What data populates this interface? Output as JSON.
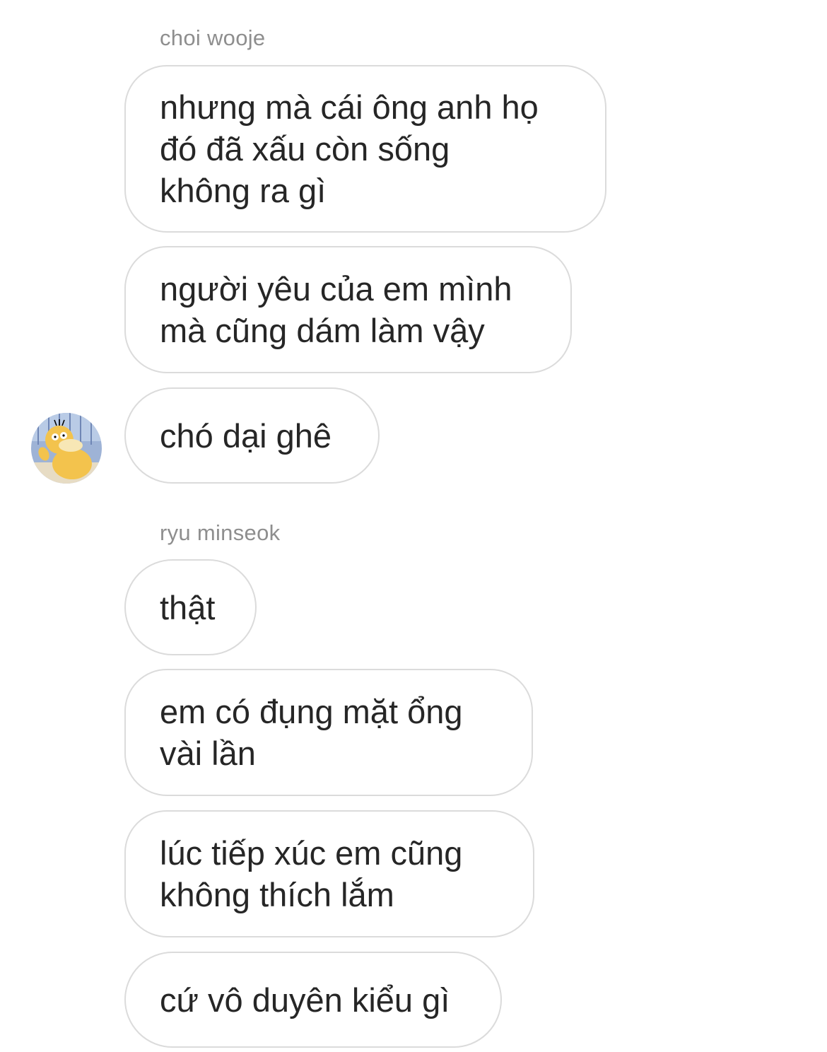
{
  "groups": [
    {
      "sender": "choi wooje",
      "messages": [
        "nhưng mà cái ông anh họ\nđó đã xấu còn sống\nkhông ra gì",
        "người yêu của em mình\nmà cũng dám làm vậy",
        "chó dại ghê"
      ],
      "avatar_icon": "psyduck-avatar-icon"
    },
    {
      "sender": "ryu minseok",
      "messages": [
        "thật",
        "em có đụng mặt ổng\nvài lần",
        "lúc tiếp xúc em cũng\nkhông thích lắm",
        "cứ vô duyên kiểu gì"
      ]
    }
  ],
  "colors": {
    "bubble_border": "#dbdbdb",
    "text": "#262626",
    "sender_name": "#8e8e8e",
    "avatar_accent": "#f3c34d"
  }
}
